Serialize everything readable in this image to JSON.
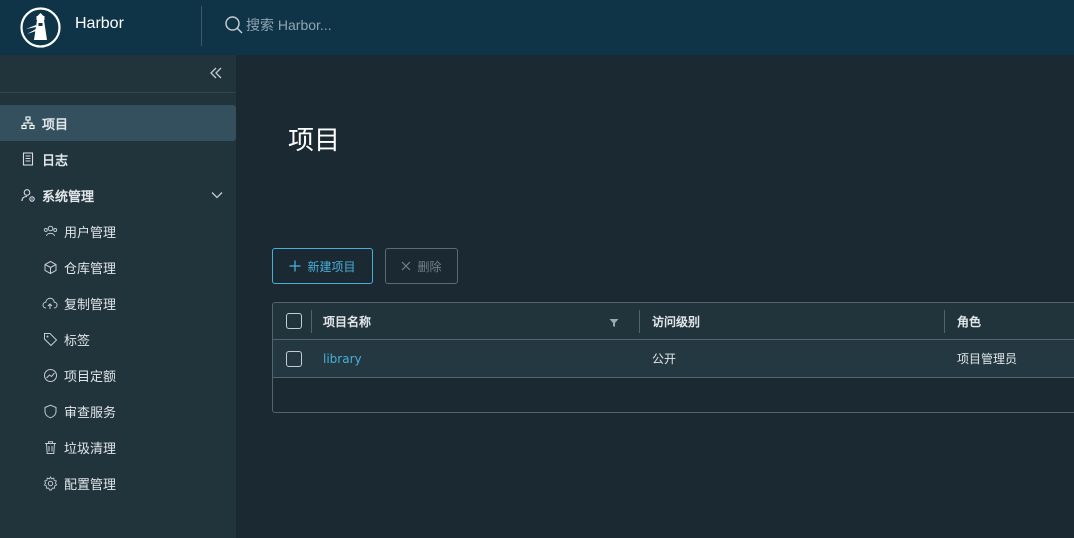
{
  "app": {
    "title": "Harbor"
  },
  "search": {
    "placeholder": "搜索 Harbor..."
  },
  "sidebar": {
    "items": [
      {
        "label": "项目",
        "icon": "projects-icon",
        "active": true
      },
      {
        "label": "日志",
        "icon": "logs-icon"
      },
      {
        "label": "系统管理",
        "icon": "admin-icon",
        "expanded": true
      },
      {
        "label": "用户管理",
        "icon": "users-icon"
      },
      {
        "label": "仓库管理",
        "icon": "registry-icon"
      },
      {
        "label": "复制管理",
        "icon": "replication-icon"
      },
      {
        "label": "标签",
        "icon": "tag-icon"
      },
      {
        "label": "项目定额",
        "icon": "quota-icon"
      },
      {
        "label": "审查服务",
        "icon": "shield-icon"
      },
      {
        "label": "垃圾清理",
        "icon": "trash-icon"
      },
      {
        "label": "配置管理",
        "icon": "gear-icon"
      }
    ]
  },
  "main": {
    "title": "项目",
    "toolbar": {
      "new_label": "新建项目",
      "delete_label": "删除"
    },
    "table": {
      "columns": [
        "项目名称",
        "访问级别",
        "角色"
      ],
      "rows": [
        {
          "name": "library",
          "access": "公开",
          "role": "项目管理员"
        }
      ]
    }
  },
  "colors": {
    "header_bg": "#0f3347",
    "sidebar_bg": "#21333b",
    "content_bg": "#1b2a32",
    "accent": "#4aaed9"
  }
}
